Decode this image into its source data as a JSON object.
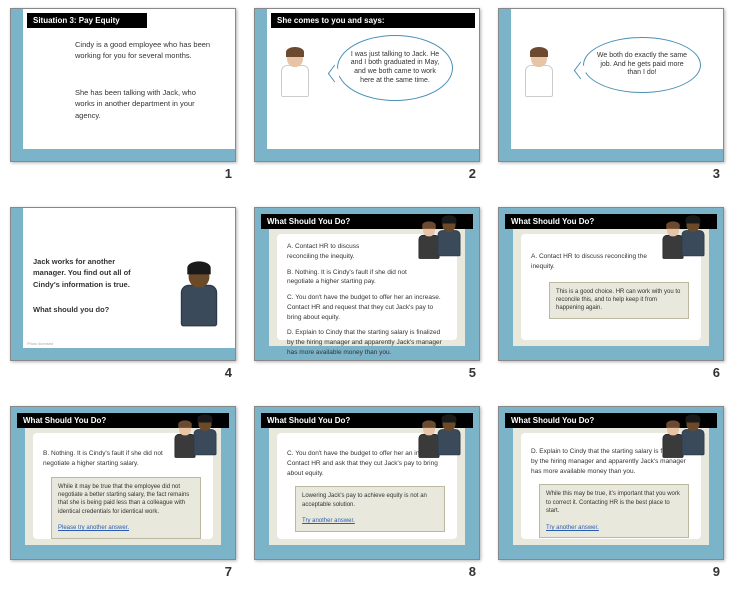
{
  "slides": {
    "s1": {
      "title": "Situation 3: Pay Equity",
      "p1": "Cindy is a good employee who has been working for you for several months.",
      "p2": "She has been talking with Jack, who works in another department in your agency."
    },
    "s2": {
      "title": "She comes to you and says:",
      "bubble": "I was just talking to Jack. He and I both graduated in May, and we both came to work here at the same time."
    },
    "s3": {
      "bubble": "We both do exactly the same job. And he gets paid more than I do!"
    },
    "s4": {
      "p1": "Jack works for another manager. You find out all of Cindy's information is true.",
      "p2": "What should you do?",
      "foot": "Photo licensed"
    },
    "s5": {
      "title": "What Should You Do?",
      "a": "A. Contact HR to discuss reconciling the inequity.",
      "b": "B. Nothing. It is Cindy's fault if she did not negotiate a higher starting pay.",
      "c": "C. You don't have the budget to offer her an increase. Contact HR and request that they cut Jack's pay to bring about equity.",
      "d": "D. Explain to Cindy that the starting salary is finalized by the hiring manager and apparently Jack's manager has more available money than you."
    },
    "s6": {
      "title": "What Should You Do?",
      "a": "A. Contact HR to discuss reconciling the inequity.",
      "fb": "This is a good choice. HR can work with you to reconcile this, and to help keep it from happening again."
    },
    "s7": {
      "title": "What Should You Do?",
      "b": "B. Nothing. It is Cindy's fault if she did not negotiate a higher starting salary.",
      "fb": "While it may be true that the employee did not negotiate a better starting salary, the fact remains that she is being paid less than a colleague with identical credentials for identical work.",
      "link": "Please try another answer."
    },
    "s8": {
      "title": "What Should You Do?",
      "c": "C. You don't have the budget to offer her an increase. Contact HR and ask that they cut Jack's pay to bring about equity.",
      "fb": "Lowering Jack's pay to achieve equity is not an acceptable solution.",
      "link": "Try another answer."
    },
    "s9": {
      "title": "What Should You Do?",
      "d": "D. Explain to Cindy that the starting salary is finalized by the hiring manager and apparently Jack's manager has more available money than you.",
      "fb": "While this may be true, it's important that you work to correct it. Contacting HR is the best place to start.",
      "link": "Try another answer."
    }
  }
}
